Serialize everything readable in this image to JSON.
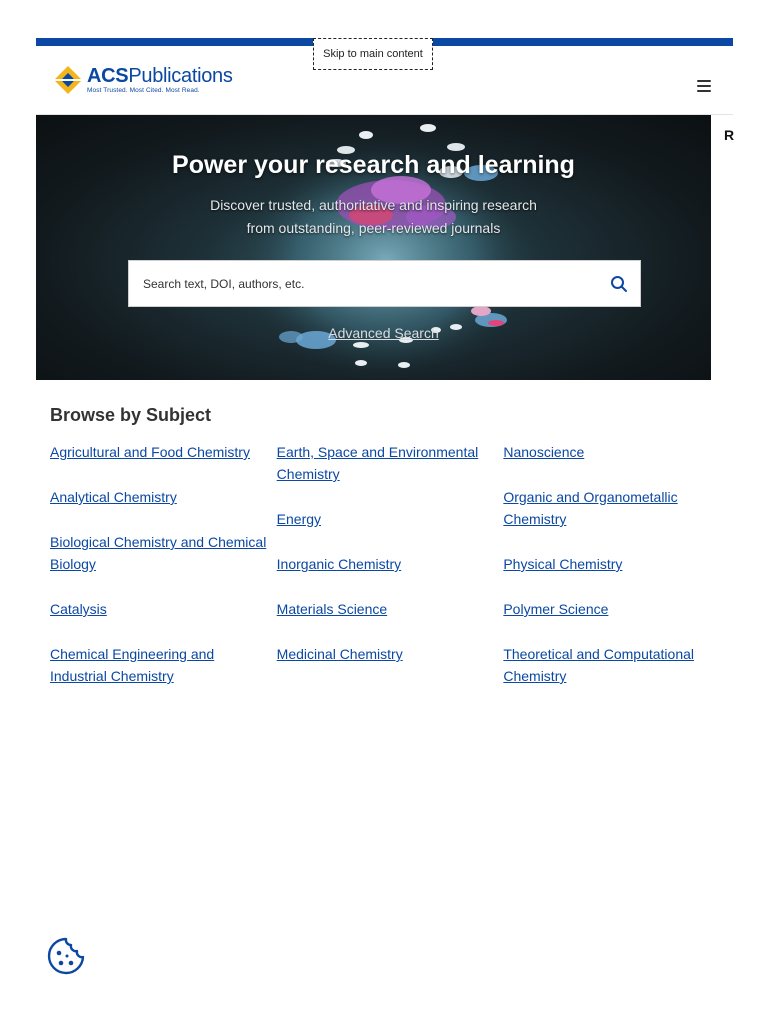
{
  "skip_link": "Skip to main content",
  "header": {
    "logo_main_bold": "ACS",
    "logo_main_rest": "Publications",
    "logo_tagline": "Most Trusted. Most Cited. Most Read.",
    "side_letter": "R"
  },
  "hero": {
    "title": "Power your research and learning",
    "subtitle": "Discover trusted, authoritative and inspiring research from outstanding, peer-reviewed journals",
    "search_placeholder": "Search text, DOI, authors, etc.",
    "advanced_search": "Advanced Search"
  },
  "browse": {
    "title": "Browse by Subject",
    "columns": [
      [
        "Agricultural and Food Chemistry",
        "Analytical Chemistry",
        "Biological Chemistry and Chemical Biology",
        "Catalysis",
        "Chemical Engineering and Industrial Chemistry"
      ],
      [
        "Earth, Space and Environmental Chemistry",
        "Energy",
        "Inorganic Chemistry",
        "Materials Science",
        "Medicinal Chemistry"
      ],
      [
        "Nanoscience",
        "Organic and Organometallic Chemistry",
        "Physical Chemistry",
        "Polymer Science",
        "Theoretical and Computational Chemistry"
      ]
    ]
  },
  "colors": {
    "brand_blue": "#0b48a3",
    "logo_gold": "#f3b51b"
  }
}
